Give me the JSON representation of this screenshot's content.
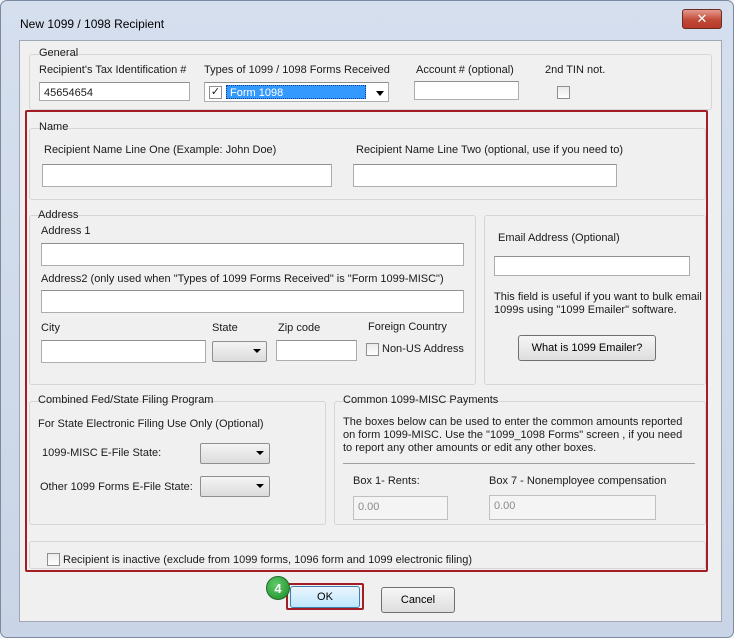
{
  "window": {
    "title": "New 1099 / 1098 Recipient",
    "close_icon": "✕"
  },
  "general": {
    "legend": "General",
    "tin_label": "Recipient's Tax Identification #",
    "tin_value": "45654654",
    "types_label": "Types of 1099 / 1098 Forms Received",
    "types_selected": "Form 1098",
    "types_checked": "✓",
    "account_label": "Account # (optional)",
    "account_value": "",
    "second_tin_label": "2nd TIN not."
  },
  "name": {
    "legend": "Name",
    "line_one_label": "Recipient Name Line One (Example: John Doe)",
    "line_one_value": "",
    "line_two_label": "Recipient Name Line Two (optional, use if you need to)",
    "line_two_value": ""
  },
  "address": {
    "legend": "Address",
    "address1_label": "Address 1",
    "address1_value": "",
    "address2_label": "Address2 (only used when \"Types of 1099 Forms Received\" is \"Form 1099-MISC\")",
    "address2_value": "",
    "city_label": "City",
    "state_label": "State",
    "zip_label": "Zip code",
    "foreign_label": "Foreign Country",
    "non_us_label": "Non-US Address"
  },
  "email": {
    "label": "Email Address (Optional)",
    "value": "",
    "help_line1": "This field is useful if you want to bulk email",
    "help_line2": "1099s using \"1099 Emailer\" software.",
    "button": "What is 1099 Emailer?"
  },
  "filing": {
    "legend": "Combined Fed/State Filing Program",
    "subtitle": "For State Electronic Filing Use Only (Optional)",
    "misc_label": "1099-MISC E-File State:",
    "other_label": "Other 1099 Forms E-File State:"
  },
  "payments": {
    "legend": "Common 1099-MISC Payments",
    "desc_line1": "The boxes below can be used to enter the common amounts reported",
    "desc_line2": "on form 1099-MISC. Use the \"1099_1098 Forms\" screen , if you need",
    "desc_line3": "to report any other amounts or edit any other boxes.",
    "box1_label": "Box 1- Rents:",
    "box1_value": "0.00",
    "box7_label": "Box 7 - Nonemployee compensation",
    "box7_value": "0.00"
  },
  "inactive_label": "Recipient is inactive (exclude from 1099 forms, 1096 form and 1099 electronic filing)",
  "step_badge": "4",
  "buttons": {
    "ok": "OK",
    "cancel": "Cancel"
  },
  "colors": {
    "highlight_red": "#a31d24",
    "badge_green": "#2f9e3a",
    "selection_blue": "#3399ff"
  }
}
